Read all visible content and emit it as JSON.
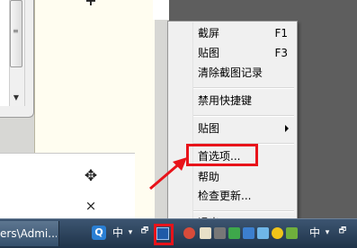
{
  "menu": {
    "items": [
      {
        "label": "截屏",
        "shortcut": "F1"
      },
      {
        "label": "贴图",
        "shortcut": "F3"
      },
      {
        "label": "清除截图记录",
        "shortcut": ""
      },
      {
        "label": "禁用快捷键",
        "shortcut": ""
      },
      {
        "label": "贴图",
        "shortcut": ""
      },
      {
        "label": "首选项...",
        "shortcut": ""
      },
      {
        "label": "帮助",
        "shortcut": ""
      },
      {
        "label": "检查更新...",
        "shortcut": ""
      },
      {
        "label": "退出",
        "shortcut": ""
      }
    ]
  },
  "taskbar": {
    "window_button": "ers\\Admi...",
    "ime_left": "中",
    "ime_right": "中",
    "dropdown": "▾",
    "restore": "🗗"
  },
  "canvas": {
    "plus": "+",
    "close": "×",
    "move": "✥"
  },
  "colors": {
    "annotation_red": "#e8131a",
    "taskbar": "#2b4058",
    "menu_bg": "#f0f0f0"
  },
  "icons": [
    "scroll-thumb",
    "scroll-down-icon",
    "move-icon",
    "close-icon",
    "submenu-arrow-icon",
    "qq-icon",
    "screenshot-app-icon"
  ]
}
